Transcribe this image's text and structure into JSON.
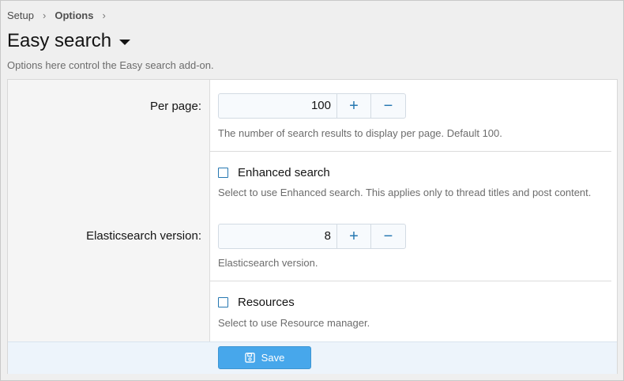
{
  "breadcrumb": {
    "items": [
      "Setup",
      "Options"
    ]
  },
  "page": {
    "title": "Easy search",
    "description": "Options here control the Easy search add-on."
  },
  "options": {
    "per_page": {
      "label": "Per page:",
      "value": "100",
      "hint": "The number of search results to display per page. Default 100."
    },
    "enhanced_search": {
      "label": "Enhanced search",
      "checked": false,
      "hint": "Select to use Enhanced search. This applies only to thread titles and post content."
    },
    "elasticsearch_version": {
      "label": "Elasticsearch version:",
      "value": "8",
      "hint": "Elasticsearch version."
    },
    "resources": {
      "label": "Resources",
      "checked": false,
      "hint": "Select to use Resource manager."
    }
  },
  "controls": {
    "increment": "+",
    "decrement": "−"
  },
  "footer": {
    "save_label": "Save"
  },
  "colors": {
    "accent": "#2577b1",
    "button": "#47a7eb",
    "footer_bg": "#edf4fb"
  }
}
